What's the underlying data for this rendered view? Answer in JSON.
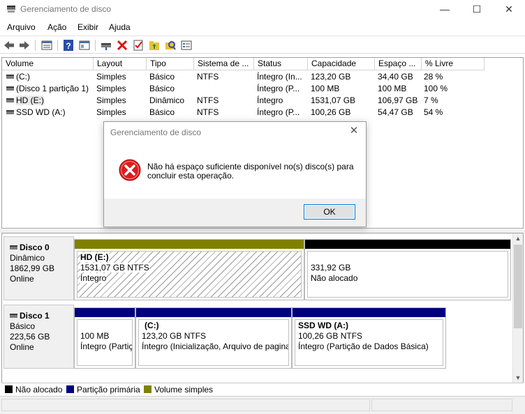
{
  "window": {
    "title": "Gerenciamento de disco",
    "minimize": "—",
    "maximize": "☐",
    "close": "✕"
  },
  "menu": [
    "Arquivo",
    "Ação",
    "Exibir",
    "Ajuda"
  ],
  "toolbar_icons": [
    "back-icon",
    "forward-icon",
    "list-view-icon",
    "help-icon",
    "console-view-icon",
    "connect-drive-icon",
    "delete-icon",
    "properties-icon",
    "open-folder-icon",
    "explore-icon",
    "details-icon"
  ],
  "volumes": {
    "columns": [
      "Volume",
      "Layout",
      "Tipo",
      "Sistema de ...",
      "Status",
      "Capacidade",
      "Espaço ...",
      "% Livre"
    ],
    "rows": [
      [
        "(C:)",
        "Simples",
        "Básico",
        "NTFS",
        "Íntegro (In...",
        "123,20 GB",
        "34,40 GB",
        "28 %"
      ],
      [
        "(Disco 1 partição 1)",
        "Simples",
        "Básico",
        "",
        "Íntegro (P...",
        "100 MB",
        "100 MB",
        "100 %"
      ],
      [
        "HD (E:)",
        "Simples",
        "Dinâmico",
        "NTFS",
        "Íntegro",
        "1531,07 GB",
        "106,97 GB",
        "7 %"
      ],
      [
        "SSD WD (A:)",
        "Simples",
        "Básico",
        "NTFS",
        "Íntegro (P...",
        "100,26 GB",
        "54,47 GB",
        "54 %"
      ]
    ]
  },
  "disks": [
    {
      "name": "Disco 0",
      "type": "Dinâmico",
      "size": "1862,99 GB",
      "state": "Online",
      "partitions": [
        {
          "title": "HD  (E:)",
          "line1": "1531,07 GB NTFS",
          "line2": "Íntegro"
        },
        {
          "title": "",
          "line1": "331,92 GB",
          "line2": "Não alocado"
        }
      ]
    },
    {
      "name": "Disco 1",
      "type": "Básico",
      "size": "223,56 GB",
      "state": "Online",
      "partitions": [
        {
          "title": "",
          "line1": "100 MB",
          "line2": "Íntegro (Partiç"
        },
        {
          "title": "(C:)",
          "line1": "123,20 GB NTFS",
          "line2": "Íntegro (Inicialização, Arquivo de pagina"
        },
        {
          "title": "SSD WD  (A:)",
          "line1": "100,26 GB NTFS",
          "line2": "Íntegro (Partição de Dados Básica)"
        }
      ]
    }
  ],
  "legend": [
    {
      "label": "Não alocado",
      "color": "#000000"
    },
    {
      "label": "Partição primária",
      "color": "#000080"
    },
    {
      "label": "Volume simples",
      "color": "#808000"
    }
  ],
  "colors": {
    "unallocated": "#000000",
    "primary_partition": "#000080",
    "simple_volume": "#808000",
    "dialog_button_border": "#0078d7"
  },
  "dialog": {
    "title": "Gerenciamento de disco",
    "icon": "error-icon",
    "message": "Não há espaço suficiente disponível no(s) disco(s) para concluir esta operação.",
    "ok_label": "OK",
    "close_label": "✕"
  }
}
